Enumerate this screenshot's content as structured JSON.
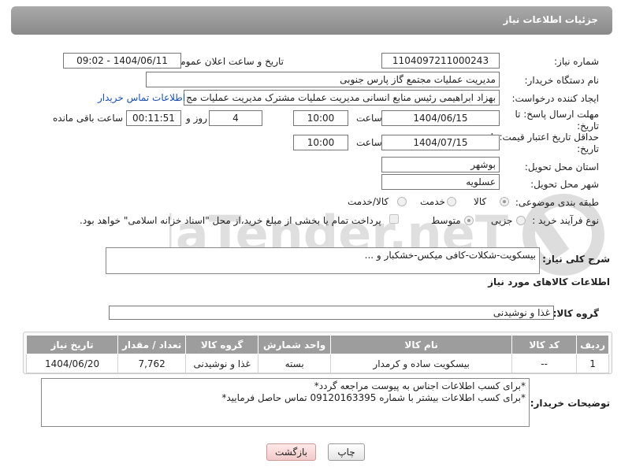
{
  "header": {
    "title": "جزئیات اطلاعات نیاز"
  },
  "fields": {
    "need_number": {
      "label": "شماره نیاز:",
      "value": "1104097211000243"
    },
    "announce_datetime": {
      "label": "تاریخ و ساعت اعلان عمومی:",
      "value": "1404/06/11 - 09:02"
    },
    "buyer_org": {
      "label": "نام دستگاه خریدار:",
      "value": "مدیریت عملیات مجتمع گاز پارس جنوبی"
    },
    "requester": {
      "label": "ایجاد کننده درخواست:",
      "value": "بهزاد ابراهیمی رئیس منابع انسانی مدیریت عملیات مشترک  مدیریت عملیات مج",
      "contact_link": "اطلاعات تماس خریدار"
    },
    "response_deadline": {
      "label": "مهلت ارسال پاسخ: تا تاریخ:",
      "date": "1404/06/15",
      "time_label": "ساعت",
      "time": "10:00",
      "days": "4",
      "days_label": "روز و",
      "remaining": "00:11:51",
      "remaining_label": "ساعت باقی مانده"
    },
    "price_validity": {
      "label": "حداقل تاریخ اعتبار قیمت: تا تاریخ:",
      "date": "1404/07/15",
      "time_label": "ساعت",
      "time": "10:00"
    },
    "province": {
      "label": "استان محل تحویل:",
      "value": "بوشهر"
    },
    "city": {
      "label": "شهر محل تحویل:",
      "value": "عسلویه"
    },
    "category": {
      "label": "طبقه بندی موضوعی:",
      "options": [
        "کالا",
        "خدمت",
        "کالا/خدمت"
      ]
    },
    "process": {
      "label": "نوع فرآیند خرید :",
      "options": [
        "جزیی",
        "متوسط"
      ],
      "note": "پرداخت تمام یا بخشی از مبلغ خرید،از محل \"اسناد خزانه اسلامی\" خواهد بود."
    },
    "description": {
      "label": "شرح کلی نیاز:",
      "value": "بیسکویت-شکلات-کافی میکس-خشکبار و ..."
    }
  },
  "goods": {
    "section_title": "اطلاعات کالاهای مورد نیاز",
    "group_label": "گروه کالا:",
    "group_value": "غذا و نوشیدنی",
    "columns": [
      "ردیف",
      "کد کالا",
      "نام کالا",
      "واحد شمارش",
      "گروه کالا",
      "تعداد / مقدار",
      "تاریخ نیاز"
    ],
    "rows": [
      [
        "1",
        "--",
        "بیسکویت ساده و کرمدار",
        "بسته",
        "غذا و نوشیدنی",
        "7,762",
        "1404/06/20"
      ]
    ]
  },
  "buyer_notes": {
    "label": "توضیحات خریدار:",
    "value": "*برای کسب اطلاعات اجناس به پیوست مراجعه گردد*\n*برای کسب اطلاعات بیشتر با شماره 09120163395 تماس حاصل فرمایید*"
  },
  "buttons": {
    "print": "چاپ",
    "back": "بازگشت"
  },
  "watermark": {
    "text": "AriaTender.neT"
  },
  "colors": {
    "header_bg": "#9a9a9a",
    "link": "#1a4fb3",
    "back_button": "#f3caca"
  }
}
